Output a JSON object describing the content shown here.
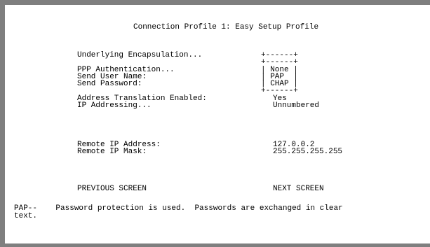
{
  "title": "Connection Profile 1: Easy Setup Profile",
  "fields": {
    "encapsulation_label": "Underlying Encapsulation...",
    "ppp_auth_label": "PPP Authentication...",
    "send_user_label": "Send User Name:",
    "send_password_label": "Send Password:",
    "address_translation_label": "Address Translation Enabled:",
    "address_translation_value": "Yes",
    "ip_addressing_label": "IP Addressing...",
    "ip_addressing_value": "Unnumbered",
    "remote_ip_label": "Remote IP Address:",
    "remote_ip_value": "127.0.0.2",
    "remote_mask_label": "Remote IP Mask:",
    "remote_mask_value": "255.255.255.255"
  },
  "popup": {
    "border_top": "+------+",
    "border_top_inner": "+------+",
    "options": [
      "| None |",
      "| PAP  |",
      "| CHAP |"
    ],
    "border_bottom": "+------+"
  },
  "nav": {
    "previous": "PREVIOUS SCREEN",
    "next": "NEXT SCREEN"
  },
  "help": {
    "line1": "PAP--    Password protection is used.  Passwords are exchanged in clear",
    "line2": "text."
  }
}
